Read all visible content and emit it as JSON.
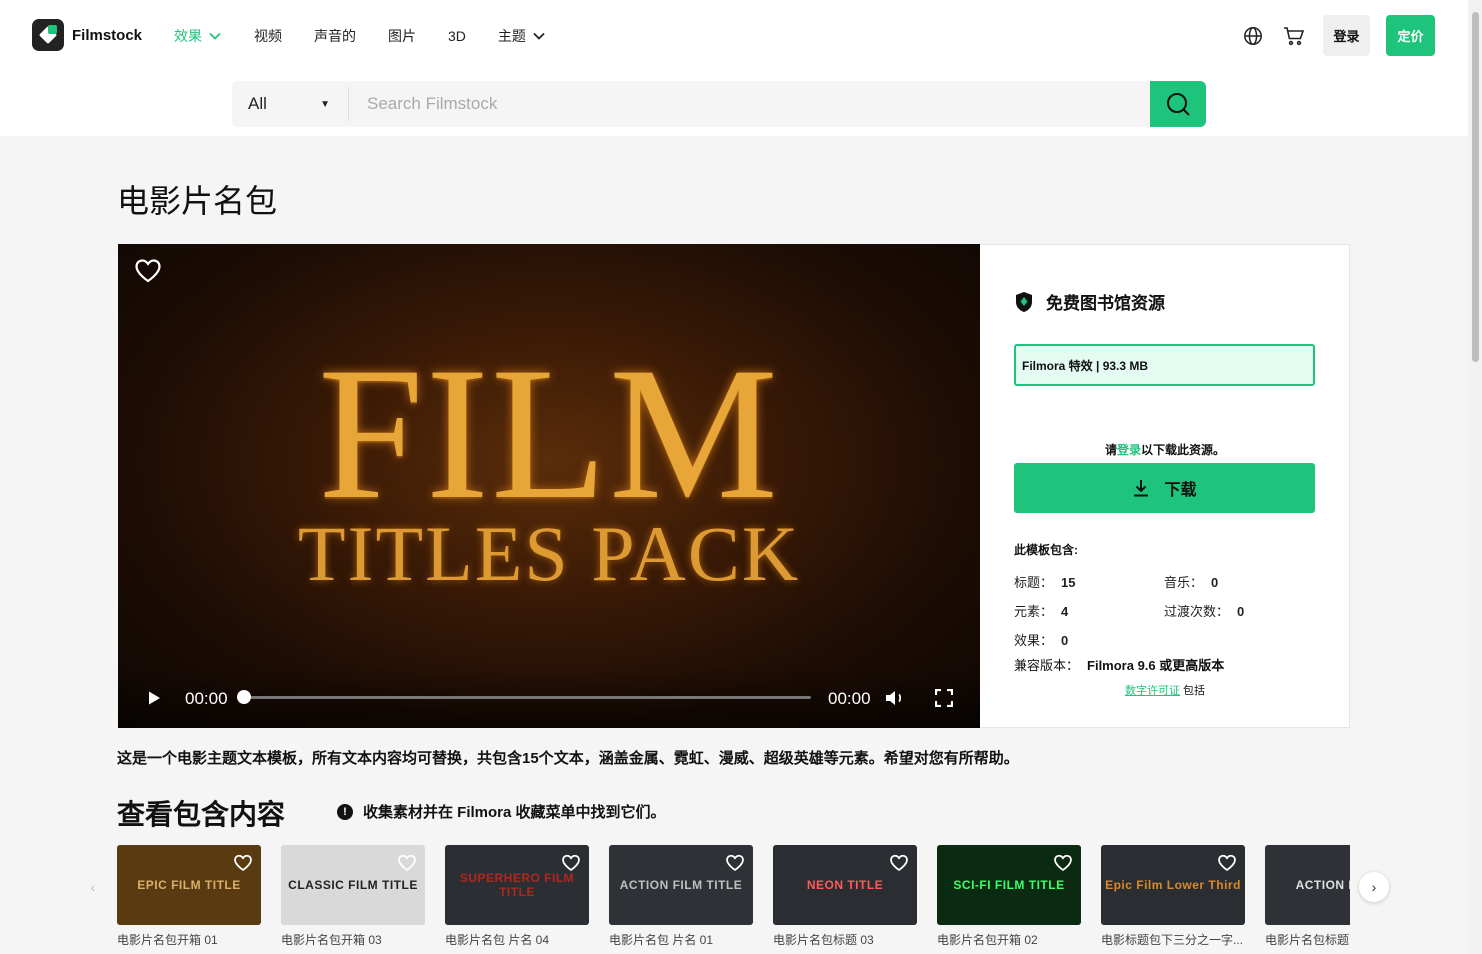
{
  "header": {
    "logo_text": "Filmstock",
    "nav": [
      {
        "label": "效果",
        "active": true,
        "dropdown": true
      },
      {
        "label": "视频"
      },
      {
        "label": "声音的"
      },
      {
        "label": "图片"
      },
      {
        "label": "3D"
      },
      {
        "label": "主题",
        "dropdown": true
      }
    ],
    "login_label": "登录",
    "pricing_label": "定价"
  },
  "search": {
    "category": "All",
    "placeholder": "Search Filmstock"
  },
  "page_title": "电影片名包",
  "video": {
    "title_big": "FILM",
    "title_sub": "TITLES PACK",
    "time_current": "00:00",
    "time_total": "00:00",
    "progress": 0
  },
  "panel": {
    "title": "免费图书馆资源",
    "file_info": "Filmora 特效 | 93.3 MB",
    "login_prefix": "请",
    "login_link": "登录",
    "login_suffix": "以下载此资源。",
    "download_label": "下载",
    "includes_title": "此模板包含:",
    "stats": [
      {
        "label": "标题：",
        "value": "15"
      },
      {
        "label": "音乐：",
        "value": "0"
      },
      {
        "label": "元素：",
        "value": "4"
      },
      {
        "label": "过渡次数：",
        "value": "0"
      },
      {
        "label": "效果：",
        "value": "0"
      }
    ],
    "compat_label": "兼容版本：",
    "compat_value": "Filmora 9.6 或更高版本",
    "license_link": "数字许可证",
    "license_suffix": " 包括"
  },
  "description": "这是一个电影主题文本模板，所有文本内容均可替换，共包含15个文本，涵盖金属、霓虹、漫威、超级英雄等元素。希望对您有所帮助。",
  "section": {
    "title": "查看包含内容",
    "note": "收集素材并在 Filmora 收藏菜单中找到它们。"
  },
  "cards": [
    {
      "label": "电影片名包开箱 01",
      "thumb_text": "EPIC FILM TITLE",
      "bg": "#5a3a10",
      "fg": "#d9b06a"
    },
    {
      "label": "电影片名包开箱 03",
      "thumb_text": "CLASSIC FILM TITLE",
      "bg": "#d9d9d9",
      "fg": "#222222"
    },
    {
      "label": "电影片名包 片名 04",
      "thumb_text": "SUPERHERO FILM TITLE",
      "bg": "#2b2e33",
      "fg": "#b3261e"
    },
    {
      "label": "电影片名包 片名 01",
      "thumb_text": "ACTION FILM TITLE",
      "bg": "#2e3136",
      "fg": "#bfbfbf"
    },
    {
      "label": "电影片名包标题 03",
      "thumb_text": "NEON TITLE",
      "bg": "#2a2d32",
      "fg": "#ff5a5a"
    },
    {
      "label": "电影片名包开箱 02",
      "thumb_text": "SCI-FI FILM TITLE",
      "bg": "#0a2a12",
      "fg": "#3cff6a"
    },
    {
      "label": "电影标题包下三分之一字...",
      "thumb_text": "Epic Film Lower Third",
      "bg": "#2a2d32",
      "fg": "#d98a2a"
    },
    {
      "label": "电影片名包标题",
      "thumb_text": "ACTION FILM",
      "bg": "#2e3136",
      "fg": "#e0e0e0"
    }
  ],
  "colors": {
    "accent": "#1ec47b"
  }
}
